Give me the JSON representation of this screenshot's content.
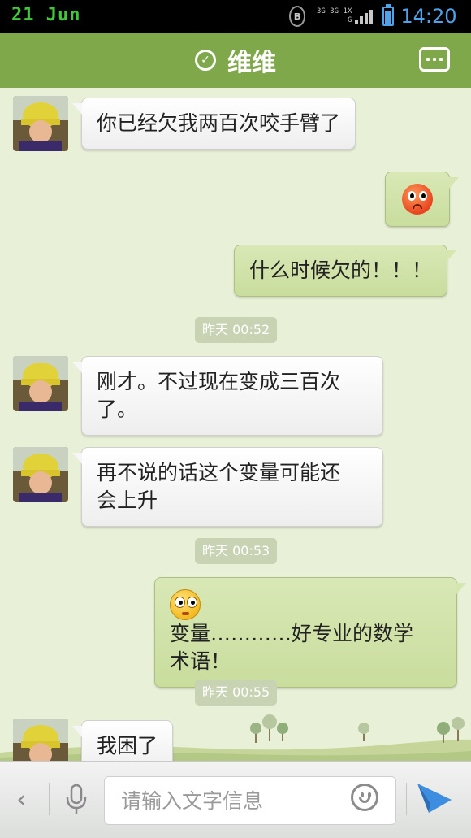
{
  "status_bar": {
    "date": "21 Jun",
    "bluetooth": "bluetooth-icon",
    "network": [
      "3G",
      "3G",
      "1X",
      "G"
    ],
    "battery_level": 0.85,
    "time": "14:20"
  },
  "header": {
    "title": "维维",
    "verified_icon": "check-circle-icon",
    "menu_icon": "more-options-icon",
    "background": "#7fa84a"
  },
  "messages": [
    {
      "side": "received",
      "lines": [
        "你已经欠我两百次咬手臂了"
      ]
    },
    {
      "side": "sent",
      "emoji": "angry-red-face-emoji"
    },
    {
      "side": "sent",
      "lines": [
        "什么时候欠的！！！"
      ]
    },
    {
      "type": "timestamp",
      "text": "昨天 00:52"
    },
    {
      "side": "received",
      "lines": [
        "刚才。不过现在变成三百次",
        "了。"
      ]
    },
    {
      "side": "received",
      "lines": [
        "再不说的话这个变量可能还",
        "会上升"
      ]
    },
    {
      "type": "timestamp",
      "text": "昨天 00:53"
    },
    {
      "side": "sent",
      "emoji": "surprised-yellow-face-emoji",
      "lines": [
        "变量…………好专业的数学",
        "术语！"
      ]
    },
    {
      "type": "timestamp",
      "text": "昨天 00:55"
    },
    {
      "side": "received",
      "lines": [
        "我困了"
      ]
    }
  ],
  "input_bar": {
    "back_icon": "chevron-left-icon",
    "voice_icon": "microphone-icon",
    "placeholder": "请输入文字信息",
    "value": "",
    "emoji_icon": "smiley-icon",
    "send_icon": "paper-plane-send-icon"
  },
  "colors": {
    "chat_background": "#e9f0d8",
    "sent_bubble": "#cfe2a8",
    "received_bubble": "#f4f4f4",
    "accent_blue": "#4ea3ea"
  }
}
